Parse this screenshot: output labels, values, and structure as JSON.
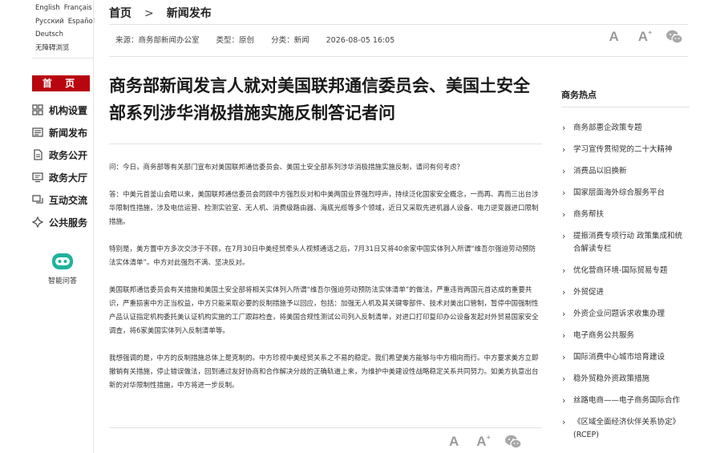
{
  "languages": {
    "row1": [
      "English",
      "Français"
    ],
    "row2": [
      "Русский",
      "Español"
    ],
    "row3": [
      "Deutsch"
    ],
    "row4": [
      "无障碍浏览"
    ]
  },
  "nav": {
    "home": "首 页",
    "items": [
      {
        "label": "机构设置",
        "icon": "grid-icon"
      },
      {
        "label": "新闻发布",
        "icon": "news-icon"
      },
      {
        "label": "政务公开",
        "icon": "document-icon"
      },
      {
        "label": "政务大厅",
        "icon": "monitor-icon"
      },
      {
        "label": "互动交流",
        "icon": "chat-icon"
      },
      {
        "label": "公共服务",
        "icon": "service-icon"
      }
    ]
  },
  "assistant": {
    "label": "智能问答",
    "icon": "robot-icon",
    "color": "#1fb39b"
  },
  "breadcrumb": {
    "home": "首页",
    "separator": ">",
    "current": "新闻发布"
  },
  "meta": {
    "source": "来源：商务部新闻办公室",
    "type": "类型：原创",
    "category": "分类：新闻",
    "date": "2026-08-05 16:05"
  },
  "tools": {
    "font_large": "A",
    "font_small": "A",
    "font_plus": "+",
    "share_icon": "wechat-icon"
  },
  "article": {
    "title": "商务部新闻发言人就对美国联邦通信委员会、美国土安全部系列涉华消极措施实施反制答记者问",
    "paragraphs": [
      "问：今日，商务部等有关部门宣布对美国联邦通信委员会、美国土安全部系列涉华消极措施实施反制，请问有何考虑？",
      "答：中美元首釜山会晤以来，美国联邦通信委员会罔顾中方强烈反对和中美两国业界强烈呼声，持续泛化国家安全概念，一而再、再而三出台涉华限制性措施，涉及电信运营、检测实验室、无人机、消费级路由器、海底光缆等多个领域，近日又采取先进机器人设备、电力逆变器进口限制措施。",
      "特别是，美方置中方多次交涉于不顾，在7月30日中美经贸牵头人视频通话之后，7月31日又将40余家中国实体列入所谓“维吾尔强迫劳动预防法实体清单”。中方对此强烈不满、坚决反对。",
      "美国联邦通信委员会有关措施和美国土安全部将相关实体列入所谓“维吾尔强迫劳动预防法实体清单”的做法，严重违背两国元首达成的重要共识，严重损害中方正当权益，中方只能采取必要的反制措施予以回应，包括：加强无人机及其关键零部件、技术对美出口管制，暂停中国强制性产品认证指定机构委托美认证机构实施的工厂跟踪检查，将美国合规性测试公司列入反制清单，对进口打印复印办公设备发起对外贸易国家安全调查，将6家美国实体列入反制清单等。",
      "我想强调的是，中方的反制措施总体上是克制的。中方珍视中美经贸关系之不易的稳定。我们希望美方能够与中方相向而行。中方要求美方立即撤销有关措施，停止错误做法，回到通过友好协商和合作解决分歧的正确轨道上来，为维护中美建设性战略稳定关系共同努力。如美方执意出台新的对华限制性措施，中方将进一步反制。"
    ]
  },
  "sidebar": {
    "title": "商务热点",
    "items": [
      "商务部惠企政策专题",
      "学习宣传贯彻党的二十大精神",
      "消费品以旧换新",
      "国家层面海外综合服务平台",
      "商务帮扶",
      "提振消费专项行动 政策集成和统合解读专栏",
      "优化营商环境-国际贸易专题",
      "外贸促进",
      "外资企业问题诉求收集办理",
      "电子商务公共服务",
      "国际消费中心城市培育建设",
      "稳外贸稳外资政策措施",
      "丝路电商——电子商务国际合作",
      "《区域全面经济伙伴关系协定》(RCEP)"
    ]
  },
  "colors": {
    "accent": "#b8050f",
    "text": "#333333",
    "muted": "#9a9a9a",
    "divider": "#e3e3e3"
  }
}
